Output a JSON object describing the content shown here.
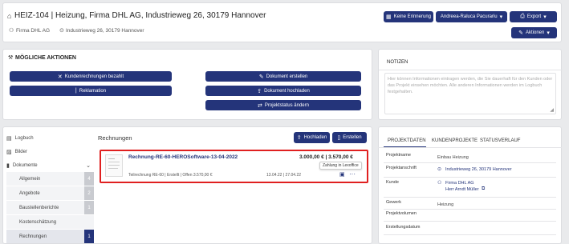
{
  "header": {
    "title": "HEIZ-104 | Heizung, Firma DHL AG, Industrieweg 26, 30179 Hannover",
    "company": "Firma DHL AG",
    "address": "Industrieweg 26, 30179 Hannover",
    "buttons": {
      "reminder": "Keine Erinnerung",
      "user": "Andreea-Raluca Pacurariu",
      "export": "Export",
      "actions": "Aktionen"
    }
  },
  "actions_panel": {
    "title": "MÖGLICHE AKTIONEN",
    "buttons": [
      "Kundenrechnungen bezahlt",
      "Reklamation",
      "Dokument erstellen",
      "Dokument hochladen",
      "Projektstatus ändern"
    ]
  },
  "notes_panel": {
    "tab": "NOTIZEN",
    "placeholder": "Hier können Informationen eintragen werden, die Sie dauerhaft für den Kunden oder das Projekt einsehen möchten. Alle anderen Informationen werden im Logbuch festgehalten."
  },
  "sidebar": {
    "items": [
      {
        "label": "Logbuch",
        "icon": "logbook-icon"
      },
      {
        "label": "Bilder",
        "icon": "image-icon"
      },
      {
        "label": "Dokumente",
        "icon": "document-icon"
      }
    ],
    "subitems": [
      {
        "label": "Allgemein",
        "count": "4"
      },
      {
        "label": "Angebote",
        "count": "2"
      },
      {
        "label": "Baustellenberichte",
        "count": "1"
      },
      {
        "label": "Kostenschätzung",
        "count": ""
      },
      {
        "label": "Rechnungen",
        "count": "1"
      }
    ]
  },
  "invoices": {
    "title": "Rechnungen",
    "upload_label": "Hochladen",
    "create_label": "Erstellen",
    "item": {
      "name": "Rechnung-RE-60-HEROSoftware-13-04-2022",
      "amounts": "3.000,00 € | 3.570,00 €",
      "tooltip": "Zahlung in Lexoffice",
      "meta": "Teilrechnung RE-60 | Erstellt | Offen 3.570,00 €",
      "dates": "13.04.22 | 27.04.22"
    }
  },
  "project_panel": {
    "tabs": [
      "PROJEKTDATEN",
      "KUNDENPROJEKTE",
      "STATUSVERLAUF"
    ],
    "rows": [
      {
        "label": "Projektname",
        "value": "Einbau Heizung"
      },
      {
        "label": "Projektanschrift",
        "value": "Industrieweg 26, 30179 Hannover"
      },
      {
        "label": "Kunde",
        "value": "Firma DHL AG",
        "value2": "Herr Arndt Müller"
      },
      {
        "label": "Gewerk",
        "value": "Heizung"
      },
      {
        "label": "Projektvolumen",
        "value": ""
      },
      {
        "label": "Erstellungsdatum",
        "value": ""
      }
    ]
  }
}
